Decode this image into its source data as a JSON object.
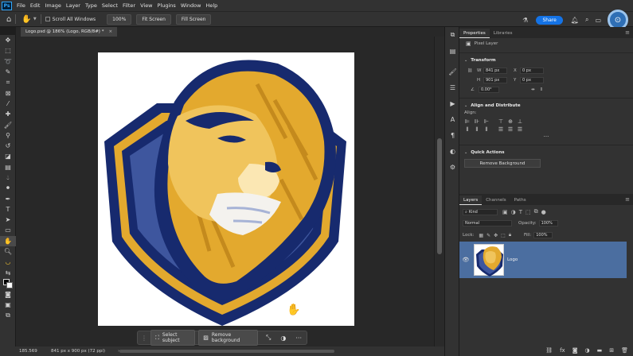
{
  "menu": {
    "app_logo": "Ps",
    "items": [
      "File",
      "Edit",
      "Image",
      "Layer",
      "Type",
      "Select",
      "Filter",
      "View",
      "Plugins",
      "Window",
      "Help"
    ]
  },
  "options": {
    "scroll_all_windows": "Scroll All Windows",
    "zoom_100": "100%",
    "fit_screen": "Fit Screen",
    "fill_screen": "Fill Screen",
    "share": "Share"
  },
  "document": {
    "tab_title": "Logo.psd @ 186% (Logo, RGB/8#) *",
    "close": "×"
  },
  "context_bar": {
    "select_subject": "Select subject",
    "remove_background": "Remove background",
    "more": "···"
  },
  "status": {
    "zoom": "185.569",
    "doc_info": "841 px x 900 px (72 ppi)",
    "arrow": "›"
  },
  "properties": {
    "tabs": [
      "Properties",
      "Libraries"
    ],
    "layer_type": "Pixel Layer",
    "transform_title": "Transform",
    "w_label": "W",
    "w_value": "841 px",
    "h_label": "H",
    "h_value": "901 px",
    "x_label": "X",
    "x_value": "0 px",
    "y_label": "Y",
    "y_value": "0 px",
    "angle_value": "0.00°",
    "align_title": "Align and Distribute",
    "align_label": "Align:",
    "more": "···",
    "quick_actions_title": "Quick Actions",
    "remove_background": "Remove Background"
  },
  "layers": {
    "tabs": [
      "Layers",
      "Channels",
      "Paths"
    ],
    "filter_kind": "Kind",
    "blend_mode": "Normal",
    "opacity_label": "Opacity:",
    "opacity_value": "100%",
    "lock_label": "Lock:",
    "fill_label": "Fill:",
    "fill_value": "100%",
    "layer_name": "Logo"
  },
  "colors": {
    "accent": "#1473e6",
    "selected_layer": "#4b6ea0",
    "lion_navy": "#172a6e",
    "lion_gold": "#e3a92e",
    "shield_blue": "#3e569e"
  }
}
